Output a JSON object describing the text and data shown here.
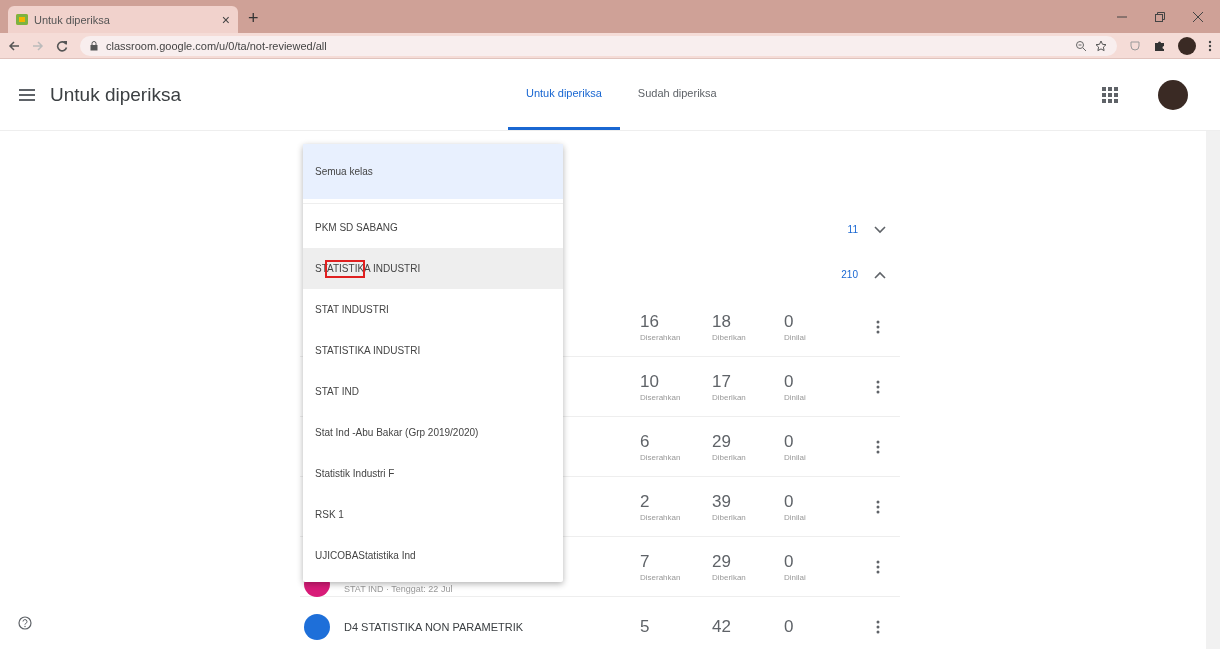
{
  "browser": {
    "tab_title": "Untuk diperiksa",
    "tab_close": "×",
    "new_tab": "+",
    "url": "classroom.google.com/u/0/ta/not-reviewed/all"
  },
  "header": {
    "title": "Untuk diperiksa",
    "tabs": [
      {
        "label": "Untuk diperiksa",
        "selected": true
      },
      {
        "label": "Sudah diperiksa",
        "selected": false
      }
    ]
  },
  "groups": [
    {
      "count": "11",
      "expanded": false
    },
    {
      "count": "210",
      "expanded": true
    }
  ],
  "rows": [
    {
      "stats": [
        {
          "value": "16",
          "label": "Diserahkan"
        },
        {
          "value": "18",
          "label": "Diberikan"
        },
        {
          "value": "0",
          "label": "Dinilai"
        }
      ]
    },
    {
      "stats": [
        {
          "value": "10",
          "label": "Diserahkan"
        },
        {
          "value": "17",
          "label": "Diberikan"
        },
        {
          "value": "0",
          "label": "Dinilai"
        }
      ]
    },
    {
      "stats": [
        {
          "value": "6",
          "label": "Diserahkan"
        },
        {
          "value": "29",
          "label": "Diberikan"
        },
        {
          "value": "0",
          "label": "Dinilai"
        }
      ]
    },
    {
      "stats": [
        {
          "value": "2",
          "label": "Diserahkan"
        },
        {
          "value": "39",
          "label": "Diberikan"
        },
        {
          "value": "0",
          "label": "Dinilai"
        }
      ]
    },
    {
      "color": "#d81b78",
      "subtitle": "STAT IND · Tenggat: 22 Jul",
      "stats": [
        {
          "value": "7",
          "label": "Diserahkan"
        },
        {
          "value": "29",
          "label": "Diberikan"
        },
        {
          "value": "0",
          "label": "Dinilai"
        }
      ]
    },
    {
      "color": "#1e6fd9",
      "title": "D4 STATISTIKA NON PARAMETRIK",
      "stats": [
        {
          "value": "5"
        },
        {
          "value": "42"
        },
        {
          "value": "0"
        }
      ]
    }
  ],
  "class_menu": {
    "items": [
      {
        "label": "Semua kelas",
        "selected": true,
        "hovered": false
      },
      {
        "label": "PKM SD SABANG",
        "selected": false,
        "hovered": false
      },
      {
        "label": "STATISTIKA INDUSTRI",
        "selected": false,
        "hovered": true
      },
      {
        "label": "STAT INDUSTRI",
        "selected": false,
        "hovered": false
      },
      {
        "label": "STATISTIKA INDUSTRI",
        "selected": false,
        "hovered": false
      },
      {
        "label": "STAT IND",
        "selected": false,
        "hovered": false
      },
      {
        "label": "Stat Ind -Abu Bakar (Grp 2019/2020)",
        "selected": false,
        "hovered": false
      },
      {
        "label": "Statistik Industri F",
        "selected": false,
        "hovered": false
      },
      {
        "label": "RSK 1",
        "selected": false,
        "hovered": false
      },
      {
        "label": "UJICOBAStatistika Ind",
        "selected": false,
        "hovered": false
      }
    ]
  }
}
